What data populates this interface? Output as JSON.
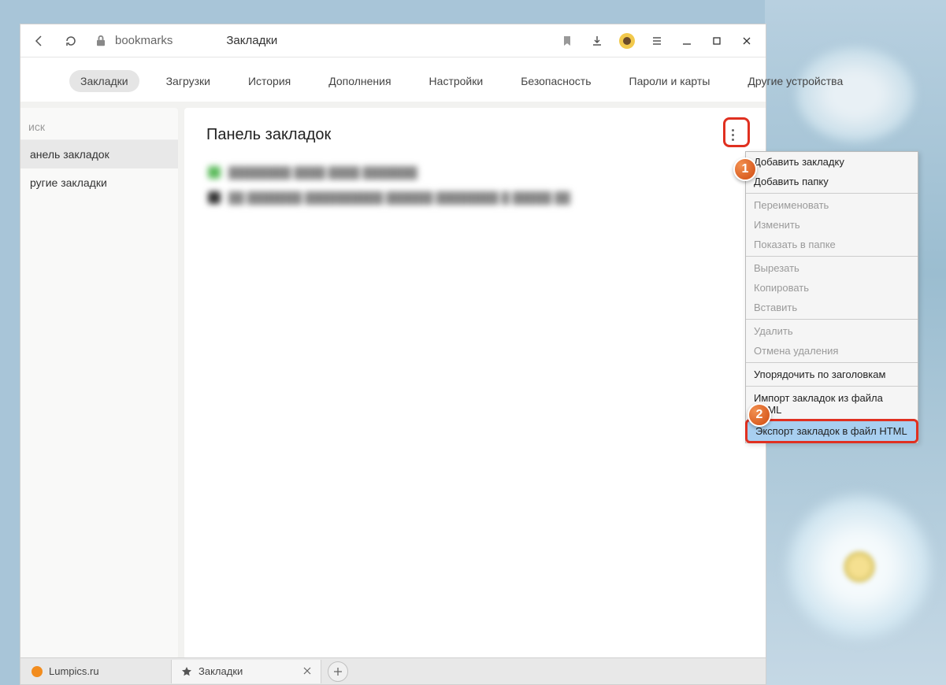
{
  "toolbar": {
    "url": "bookmarks",
    "page_title": "Закладки"
  },
  "nav": {
    "items": [
      {
        "label": "Закладки",
        "active": true
      },
      {
        "label": "Загрузки",
        "active": false
      },
      {
        "label": "История",
        "active": false
      },
      {
        "label": "Дополнения",
        "active": false
      },
      {
        "label": "Настройки",
        "active": false
      },
      {
        "label": "Безопасность",
        "active": false
      },
      {
        "label": "Пароли и карты",
        "active": false
      },
      {
        "label": "Другие устройства",
        "active": false
      }
    ]
  },
  "sidebar": {
    "search_placeholder": "иск",
    "items": [
      {
        "label": "анель закладок",
        "active": true
      },
      {
        "label": "ругие закладки",
        "active": false
      }
    ]
  },
  "panel": {
    "title": "Панель закладок"
  },
  "context_menu": {
    "items": [
      {
        "label": "Добавить закладку",
        "disabled": false
      },
      {
        "label": "Добавить папку",
        "disabled": false
      },
      {
        "sep": true
      },
      {
        "label": "Переименовать",
        "disabled": true
      },
      {
        "label": "Изменить",
        "disabled": true
      },
      {
        "label": "Показать в папке",
        "disabled": true
      },
      {
        "sep": true
      },
      {
        "label": "Вырезать",
        "disabled": true
      },
      {
        "label": "Копировать",
        "disabled": true
      },
      {
        "label": "Вставить",
        "disabled": true
      },
      {
        "sep": true
      },
      {
        "label": "Удалить",
        "disabled": true
      },
      {
        "label": "Отмена удаления",
        "disabled": true
      },
      {
        "sep": true
      },
      {
        "label": "Упорядочить по заголовкам",
        "disabled": false
      },
      {
        "sep": true
      },
      {
        "label": "Импорт закладок из файла HTML",
        "disabled": false
      },
      {
        "label": "Экспорт закладок в файл HTML",
        "disabled": false,
        "highlight": true
      }
    ]
  },
  "tabs": [
    {
      "label": "Lumpics.ru",
      "icon_color": "#f28c1e",
      "active": false
    },
    {
      "label": "Закладки",
      "star": true,
      "active": true
    }
  ],
  "badges": {
    "one": "1",
    "two": "2"
  }
}
